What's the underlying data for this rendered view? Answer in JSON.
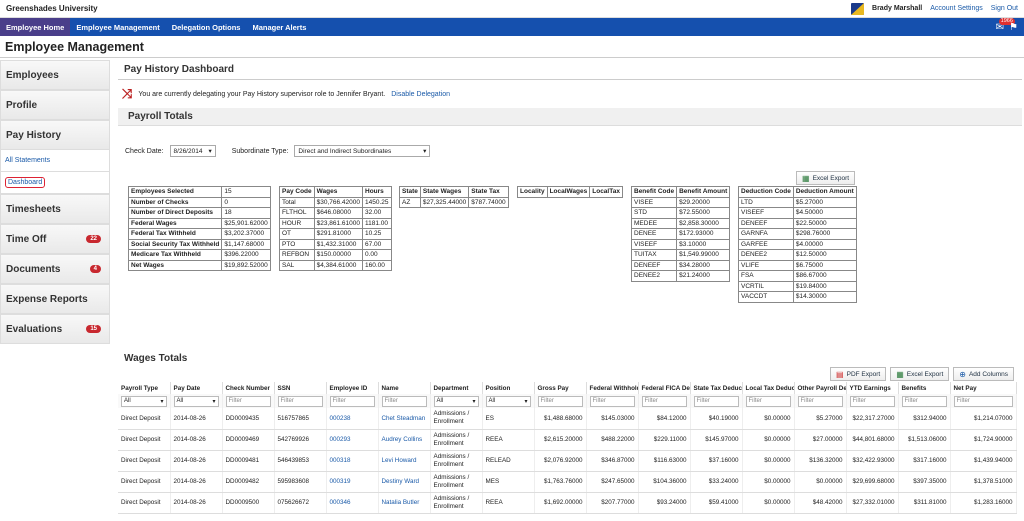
{
  "org": "Greenshades University",
  "user": {
    "name": "Brady Marshall",
    "settings": "Account Settings",
    "signout": "Sign Out"
  },
  "nav": [
    {
      "label": "Employee Home"
    },
    {
      "label": "Employee Management"
    },
    {
      "label": "Delegation Options"
    },
    {
      "label": "Manager Alerts"
    }
  ],
  "notif_count": "1966",
  "page_title": "Employee Management",
  "sidebar": {
    "employees": "Employees",
    "profile": "Profile",
    "payhistory": "Pay History",
    "all_statements": "All Statements",
    "dashboard": "Dashboard",
    "timesheets": "Timesheets",
    "timeoff": "Time Off",
    "timeoff_badge": "22",
    "documents": "Documents",
    "documents_badge": "4",
    "expense": "Expense Reports",
    "evaluations": "Evaluations",
    "evaluations_badge": "15"
  },
  "dashboard_title": "Pay History Dashboard",
  "delegation": {
    "text": "You are currently delegating your Pay History supervisor role to Jennifer Bryant.",
    "link": "Disable Delegation"
  },
  "payroll_totals": "Payroll Totals",
  "filters": {
    "check_date_label": "Check Date:",
    "check_date": "8/26/2014",
    "subordinate_label": "Subordinate Type:",
    "subordinate": "Direct and Indirect Subordinates"
  },
  "excel_export": "Excel Export",
  "summary": [
    [
      "Employees Selected",
      "15"
    ],
    [
      "Number of Checks",
      "0"
    ],
    [
      "Number of Direct Deposits",
      "18"
    ],
    [
      "Federal Wages",
      "$25,901.62000"
    ],
    [
      "Federal Tax Withheld",
      "$3,202.37000"
    ],
    [
      "Social Security Tax Withheld",
      "$1,147.68000"
    ],
    [
      "Medicare Tax Withheld",
      "$396.22000"
    ],
    [
      "Net Wages",
      "$19,892.52000"
    ]
  ],
  "paycodes": {
    "headers": [
      "Pay Code",
      "Wages",
      "Hours"
    ],
    "rows": [
      [
        "Total",
        "$30,766.42000",
        "1450.25"
      ],
      [
        "FLTHOL",
        "$646.08000",
        "32.00"
      ],
      [
        "HOUR",
        "$23,861.61000",
        "1181.00"
      ],
      [
        "OT",
        "$291.81000",
        "10.25"
      ],
      [
        "PTO",
        "$1,432.31000",
        "67.00"
      ],
      [
        "REFBON",
        "$150.00000",
        "0.00"
      ],
      [
        "SAL",
        "$4,384.61000",
        "160.00"
      ]
    ]
  },
  "state": {
    "headers": [
      "State",
      "State Wages",
      "State Tax"
    ],
    "rows": [
      [
        "AZ",
        "$27,325.44000",
        "$787.74000"
      ]
    ]
  },
  "local": {
    "headers": [
      "Locality",
      "LocalWages",
      "LocalTax"
    ]
  },
  "benefits": {
    "headers": [
      "Benefit Code",
      "Benefit Amount"
    ],
    "rows": [
      [
        "VISEE",
        "$29.20000"
      ],
      [
        "STD",
        "$72.55000"
      ],
      [
        "MEDEE",
        "$2,858.30000"
      ],
      [
        "DENEE",
        "$172.93000"
      ],
      [
        "VISEEF",
        "$3.10000"
      ],
      [
        "TUITAX",
        "$1,549.99000"
      ],
      [
        "DENEEF",
        "$34.28000"
      ],
      [
        "DENEE2",
        "$21.24000"
      ]
    ]
  },
  "deductions": {
    "headers": [
      "Deduction Code",
      "Deduction Amount"
    ],
    "rows": [
      [
        "LTD",
        "$5.27000"
      ],
      [
        "VISEEF",
        "$4.50000"
      ],
      [
        "DENEEF",
        "$22.50000"
      ],
      [
        "GARNFA",
        "$298.76000"
      ],
      [
        "GARFEE",
        "$4.00000"
      ],
      [
        "DENEE2",
        "$12.50000"
      ],
      [
        "VLIFE",
        "$6.75000"
      ],
      [
        "FSA",
        "$86.67000"
      ],
      [
        "VCRTIL",
        "$19.84000"
      ],
      [
        "VACCDT",
        "$14.30000"
      ]
    ]
  },
  "wages_totals": "Wages Totals",
  "wage_buttons": {
    "pdf": "PDF Export",
    "excel": "Excel Export",
    "columns": "Add Columns"
  },
  "wage_headers": [
    "Payroll Type",
    "Pay Date",
    "Check Number",
    "SSN",
    "Employee ID",
    "Name",
    "Department",
    "Position",
    "Gross Pay",
    "Federal Withholding",
    "Federal FICA Deductions",
    "State Tax Deductions",
    "Local Tax Deductions",
    "Other Payroll Deductions",
    "YTD Earnings",
    "Benefits",
    "Net Pay"
  ],
  "wage_filters": [
    "All",
    "All",
    "Filter",
    "Filter",
    "Filter",
    "Filter",
    "All",
    "All",
    "Filter",
    "Filter",
    "Filter",
    "Filter",
    "Filter",
    "Filter",
    "Filter",
    "Filter",
    "Filter"
  ],
  "wage_rows": [
    [
      "Direct Deposit",
      "2014-08-26",
      "DD0009435",
      "516757865",
      "000238",
      "Chet Steadman",
      "Admissions / Enrollment",
      "ES",
      "$1,488.68000",
      "$145.03000",
      "$84.12000",
      "$40.19000",
      "$0.00000",
      "$5.27000",
      "$22,317.27000",
      "$312.94000",
      "$1,214.07000"
    ],
    [
      "Direct Deposit",
      "2014-08-26",
      "DD0009469",
      "542769926",
      "000293",
      "Audrey Collins",
      "Admissions / Enrollment",
      "REEA",
      "$2,615.20000",
      "$488.22000",
      "$229.11000",
      "$145.97000",
      "$0.00000",
      "$27.00000",
      "$44,801.68000",
      "$1,513.06000",
      "$1,724.90000"
    ],
    [
      "Direct Deposit",
      "2014-08-26",
      "DD0009481",
      "546439853",
      "000318",
      "Levi Howard",
      "Admissions / Enrollment",
      "RELEAD",
      "$2,076.92000",
      "$346.87000",
      "$116.63000",
      "$37.16000",
      "$0.00000",
      "$136.32000",
      "$32,422.93000",
      "$317.16000",
      "$1,439.94000"
    ],
    [
      "Direct Deposit",
      "2014-08-26",
      "DD0009482",
      "595983608",
      "000319",
      "Destiny Ward",
      "Admissions / Enrollment",
      "MES",
      "$1,763.76000",
      "$247.65000",
      "$104.36000",
      "$33.24000",
      "$0.00000",
      "$0.00000",
      "$29,699.68000",
      "$397.35000",
      "$1,378.51000"
    ],
    [
      "Direct Deposit",
      "2014-08-26",
      "DD0009500",
      "075626672",
      "000346",
      "Natalia Butler",
      "Admissions / Enrollment",
      "REEA",
      "$1,692.00000",
      "$207.77000",
      "$93.24000",
      "$59.41000",
      "$0.00000",
      "$48.42000",
      "$27,332.01000",
      "$311.81000",
      "$1,283.16000"
    ]
  ]
}
